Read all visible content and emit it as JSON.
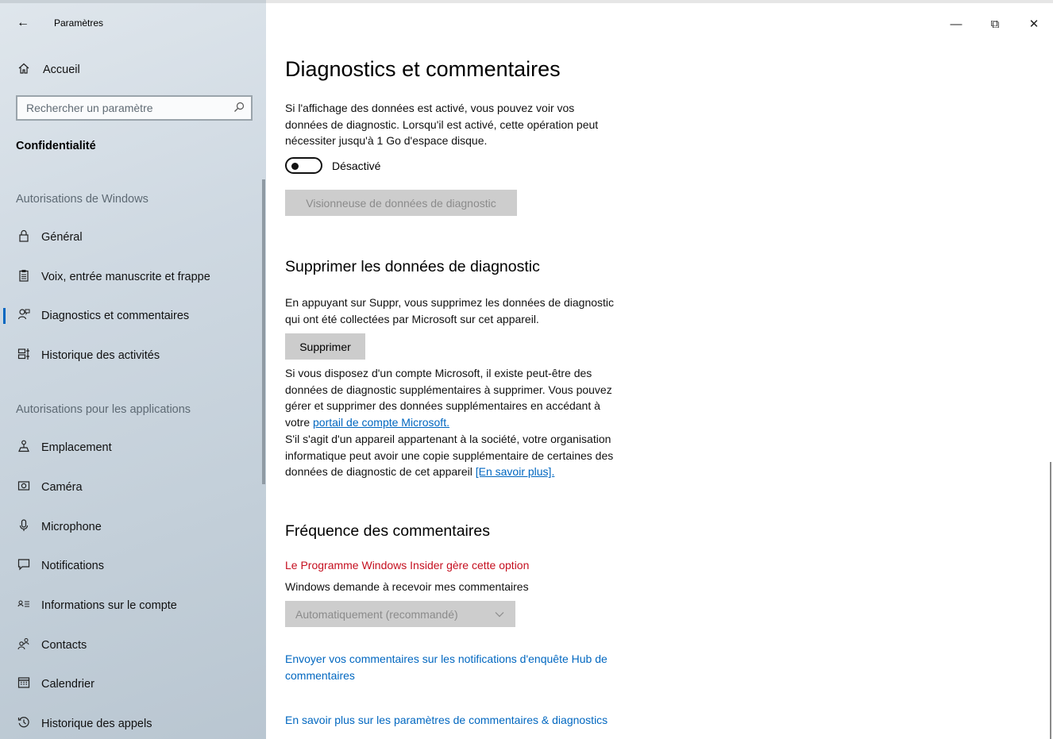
{
  "window": {
    "title": "Paramètres",
    "controls": {
      "minimize": "—",
      "restore": "⧉",
      "close": "✕"
    }
  },
  "sidebar": {
    "home": "Accueil",
    "search_placeholder": "Rechercher un paramètre",
    "section": "Confidentialité",
    "group1": "Autorisations de Windows",
    "group2": "Autorisations pour les applications",
    "items_windows": [
      {
        "label": "Général",
        "icon": "lock-icon"
      },
      {
        "label": "Voix, entrée manuscrite et frappe",
        "icon": "clipboard-icon"
      },
      {
        "label": "Diagnostics et commentaires",
        "icon": "feedback-icon",
        "active": true
      },
      {
        "label": "Historique des activités",
        "icon": "timeline-icon"
      }
    ],
    "items_apps": [
      {
        "label": "Emplacement",
        "icon": "location-icon"
      },
      {
        "label": "Caméra",
        "icon": "camera-icon"
      },
      {
        "label": "Microphone",
        "icon": "microphone-icon"
      },
      {
        "label": "Notifications",
        "icon": "notification-icon"
      },
      {
        "label": "Informations sur le compte",
        "icon": "account-info-icon"
      },
      {
        "label": "Contacts",
        "icon": "contacts-icon"
      },
      {
        "label": "Calendrier",
        "icon": "calendar-icon"
      },
      {
        "label": "Historique des appels",
        "icon": "call-history-icon"
      }
    ]
  },
  "main": {
    "title": "Diagnostics et commentaires",
    "viewer": {
      "description_l1": "Si l'affichage des données est activé, vous pouvez voir vos",
      "description_l2": "données de diagnostic. Lorsqu'il est activé, cette opération peut",
      "description_l3": "nécessiter jusqu'à 1 Go d'espace disque.",
      "toggle_label": "Désactivé",
      "toggle_on": false,
      "button": "Visionneuse de données de diagnostic"
    },
    "delete": {
      "heading": "Supprimer les données de diagnostic",
      "description_l1": "En appuyant sur Suppr, vous supprimez les données de diagnostic",
      "description_l2": "qui ont été collectées par Microsoft sur cet appareil.",
      "button": "Supprimer",
      "ms_l1": "Si vous disposez d'un compte Microsoft, il existe peut-être des",
      "ms_l2": "données de diagnostic supplémentaires à supprimer. Vous pouvez",
      "ms_l3": "gérer et supprimer des données supplémentaires en accédant à",
      "ms_l4_prefix": "votre ",
      "ms_link": "portail de compte Microsoft.",
      "org_l1": "S'il s'agit d'un appareil appartenant à la société, votre organisation",
      "org_l2": "informatique peut avoir une copie supplémentaire de certaines des",
      "org_l3_prefix": "données de diagnostic de cet appareil ",
      "org_link": "[En savoir plus]."
    },
    "frequency": {
      "heading": "Fréquence des commentaires",
      "insider_note": "Le Programme Windows Insider gère cette option",
      "label": "Windows demande à recevoir mes commentaires",
      "selected": "Automatiquement (recommandé)"
    },
    "links": {
      "hub_l1": "Envoyer vos commentaires sur les notifications d'enquête Hub de",
      "hub_l2": "commentaires",
      "learn_more": "En savoir plus sur les paramètres de commentaires & diagnostics"
    }
  },
  "colors": {
    "accent": "#0067c0",
    "warning": "#c50f1f",
    "button_bg": "#cccccc"
  }
}
